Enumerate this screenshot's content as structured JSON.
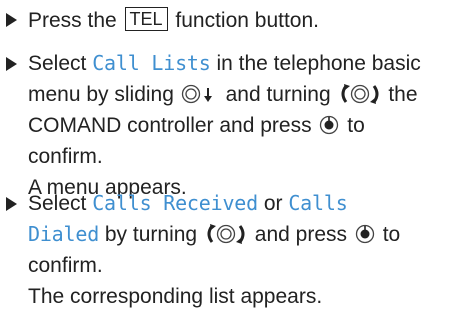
{
  "steps": [
    {
      "bullet": "arrow-right-icon",
      "text": {
        "pre": "Press the ",
        "key": "TEL",
        "post": " function button."
      }
    },
    {
      "bullet": "arrow-right-icon",
      "text": {
        "select": "Select ",
        "menu_item": "Call Lists",
        "l1_rest": " in the telephone basic",
        "l2_a": "menu by sliding ",
        "l2_b": " and turning ",
        "l2_c": " the",
        "l3_a": "COMAND controller and press ",
        "l3_b": " to",
        "l4": "confirm.",
        "result": "A menu appears."
      }
    },
    {
      "bullet": "arrow-right-icon",
      "text": {
        "select": "Select ",
        "item1": "Calls Received",
        "or": " or ",
        "item2a": "Calls",
        "item2b": "Dialed",
        "l2_a": " by turning ",
        "l2_b": " and press ",
        "l2_c": " to",
        "l3": "confirm.",
        "result": "The corresponding list appears."
      }
    }
  ],
  "icons": {
    "slide_down": "controller-slide-down-icon",
    "turn": "controller-turn-icon",
    "press": "controller-press-icon"
  },
  "colors": {
    "text": "#222222",
    "menu_item": "#3f8fd0"
  }
}
